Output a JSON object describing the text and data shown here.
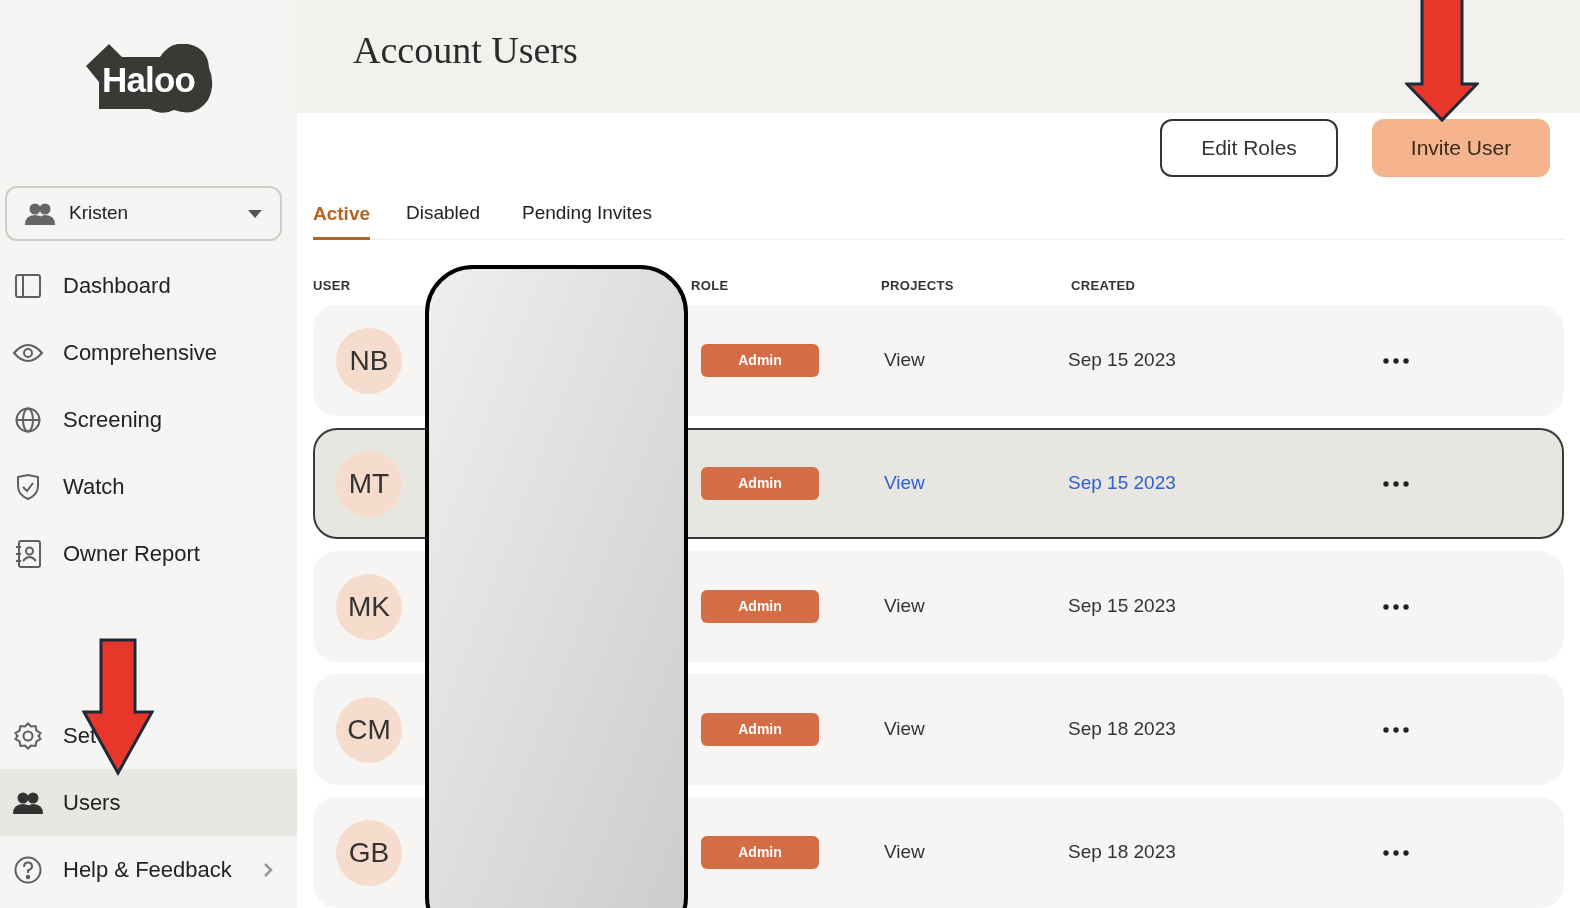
{
  "logo": {
    "text": "Haloo"
  },
  "account_switcher": {
    "name": "Kristen"
  },
  "sidebar": {
    "items": [
      {
        "label": "Dashboard",
        "selected": false
      },
      {
        "label": "Comprehensive",
        "selected": false
      },
      {
        "label": "Screening",
        "selected": false
      },
      {
        "label": "Watch",
        "selected": false
      },
      {
        "label": "Owner Report",
        "selected": false
      }
    ],
    "bottom_items": [
      {
        "label": "Set",
        "selected": false,
        "has_submenu": false
      },
      {
        "label": "Users",
        "selected": true,
        "has_submenu": false
      },
      {
        "label": "Help & Feedback",
        "selected": false,
        "has_submenu": true
      }
    ]
  },
  "page": {
    "title": "Account Users"
  },
  "buttons": {
    "edit_roles": "Edit Roles",
    "invite_user": "Invite User"
  },
  "tabs": [
    {
      "label": "Active",
      "selected": true
    },
    {
      "label": "Disabled",
      "selected": false
    },
    {
      "label": "Pending Invites",
      "selected": false
    }
  ],
  "table": {
    "columns": [
      "USER",
      "ROLE",
      "PROJECTS",
      "CREATED"
    ],
    "rows": [
      {
        "initials": "NB",
        "role": "Admin",
        "projects": "View",
        "created": "Sep 15 2023",
        "selected": false
      },
      {
        "initials": "MT",
        "role": "Admin",
        "projects": "View",
        "created": "Sep 15 2023",
        "selected": true
      },
      {
        "initials": "MK",
        "role": "Admin",
        "projects": "View",
        "created": "Sep 15 2023",
        "selected": false
      },
      {
        "initials": "CM",
        "role": "Admin",
        "projects": "View",
        "created": "Sep 18 2023",
        "selected": false
      },
      {
        "initials": "GB",
        "role": "Admin",
        "projects": "View",
        "created": "Sep 18 2023",
        "selected": false
      }
    ]
  }
}
